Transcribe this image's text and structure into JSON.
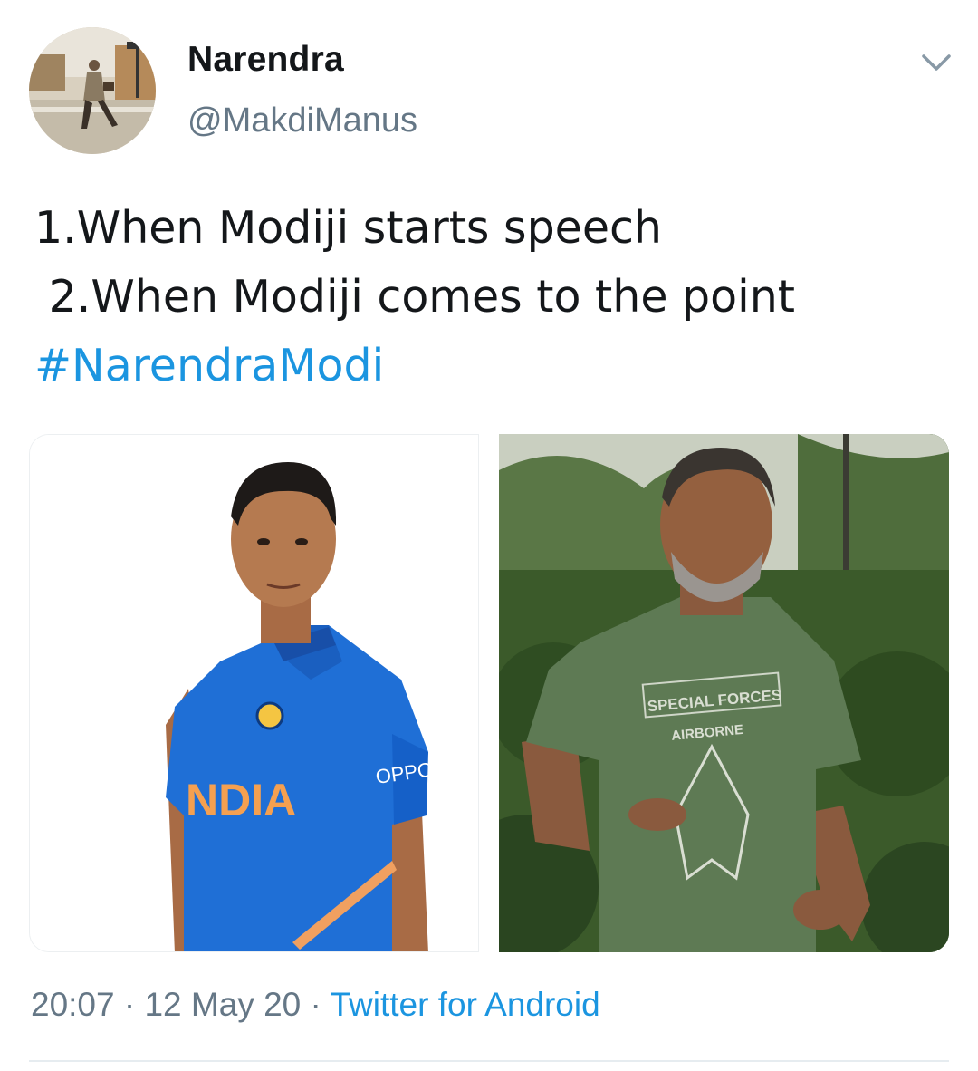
{
  "user": {
    "display_name": "Narendra",
    "handle": "@MakdiManus"
  },
  "tweet": {
    "line1": "1.When Modiji starts speech",
    "line2": " 2.When Modiji comes to the point",
    "hashtag": "#NarendraModi"
  },
  "media": {
    "left_jersey_text": "NDIA",
    "left_sponsor_text": "OPPO",
    "right_shirt_text_1": "SPECIAL FORCES",
    "right_shirt_text_2": "AIRBORNE"
  },
  "footer": {
    "time": "20:07",
    "sep1": " · ",
    "date": "12 May 20",
    "sep2": " · ",
    "source": "Twitter for Android"
  },
  "icons": {
    "menu": "chevron-down-icon",
    "avatar": "avatar-photo"
  },
  "colors": {
    "link": "#1b95e0",
    "muted": "#657786",
    "text": "#14171a"
  }
}
